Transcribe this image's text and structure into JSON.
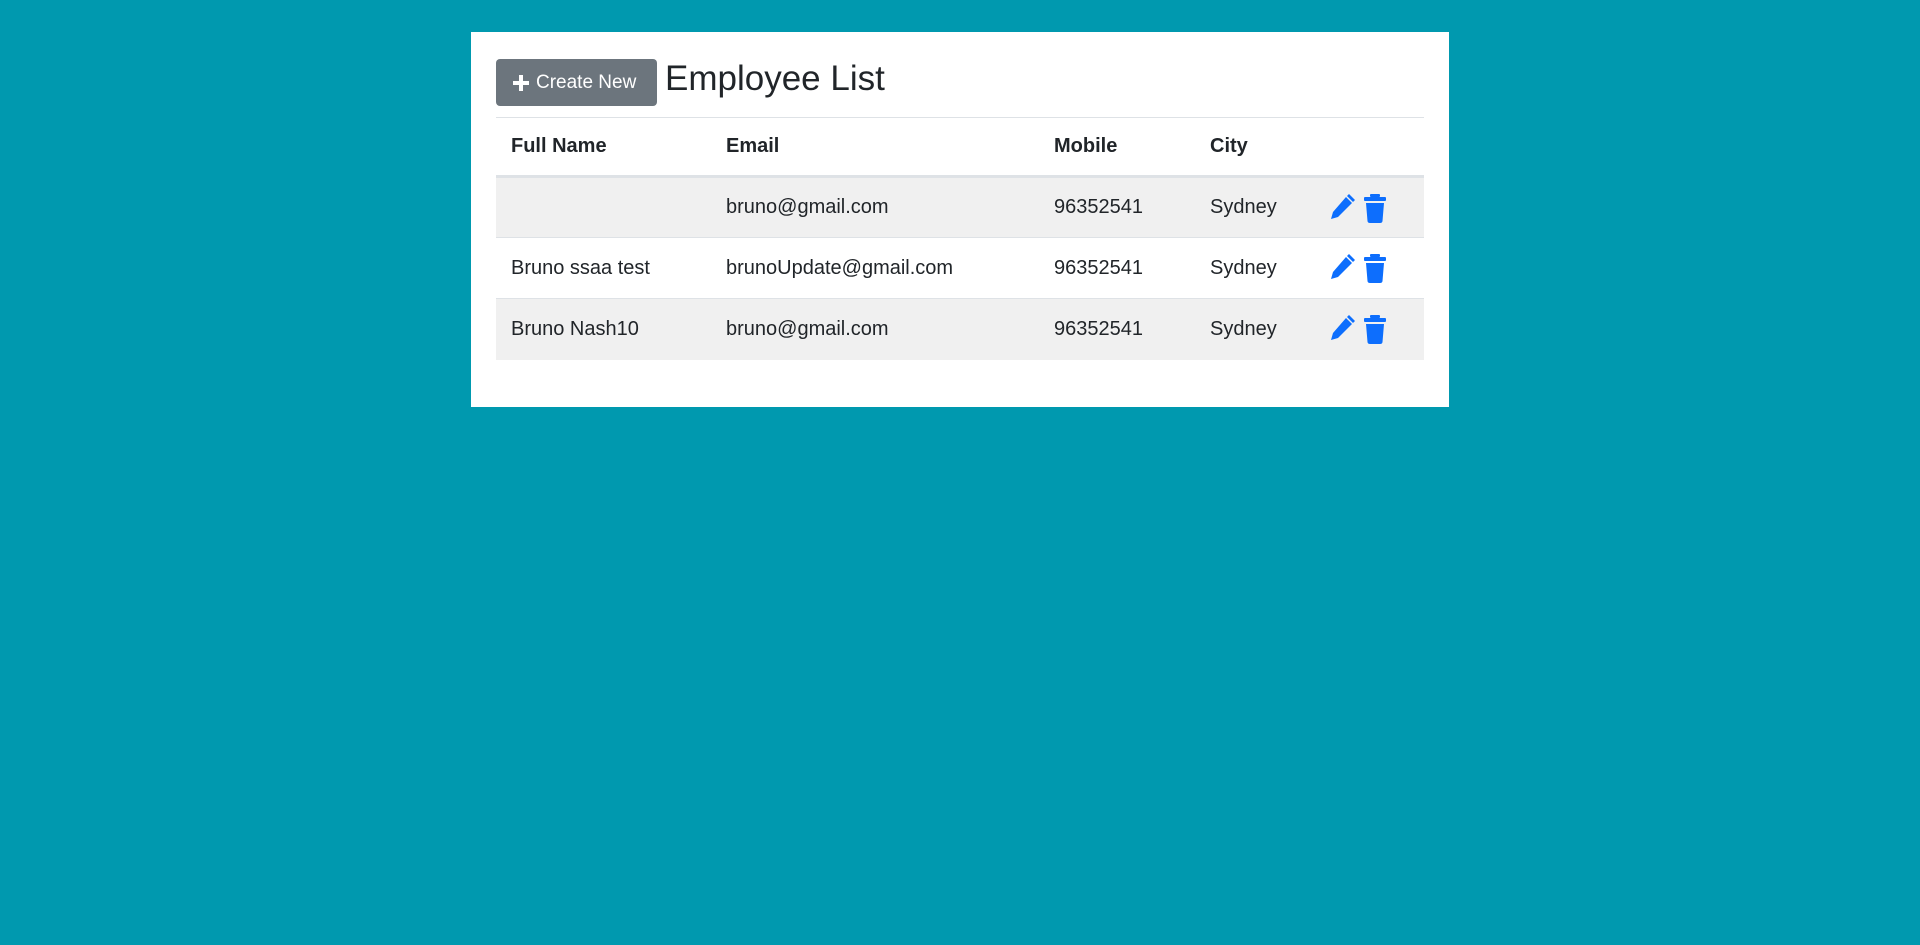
{
  "header": {
    "create_label": "Create New",
    "title": "Employee List"
  },
  "table": {
    "columns": [
      "Full Name",
      "Email",
      "Mobile",
      "City"
    ],
    "rows": [
      {
        "full_name": "",
        "email": "bruno@gmail.com",
        "mobile": "96352541",
        "city": "Sydney"
      },
      {
        "full_name": "Bruno ssaa test",
        "email": "brunoUpdate@gmail.com",
        "mobile": "96352541",
        "city": "Sydney"
      },
      {
        "full_name": "Bruno Nash10",
        "email": "bruno@gmail.com",
        "mobile": "96352541",
        "city": "Sydney"
      }
    ]
  },
  "icons": {
    "create": "plus-icon",
    "edit": "pencil-icon",
    "delete": "trash-icon"
  },
  "colors": {
    "background": "#0099af",
    "button": "#6c757d",
    "action_icons": "#0d6efd",
    "row_stripe": "#f0f0f0"
  }
}
